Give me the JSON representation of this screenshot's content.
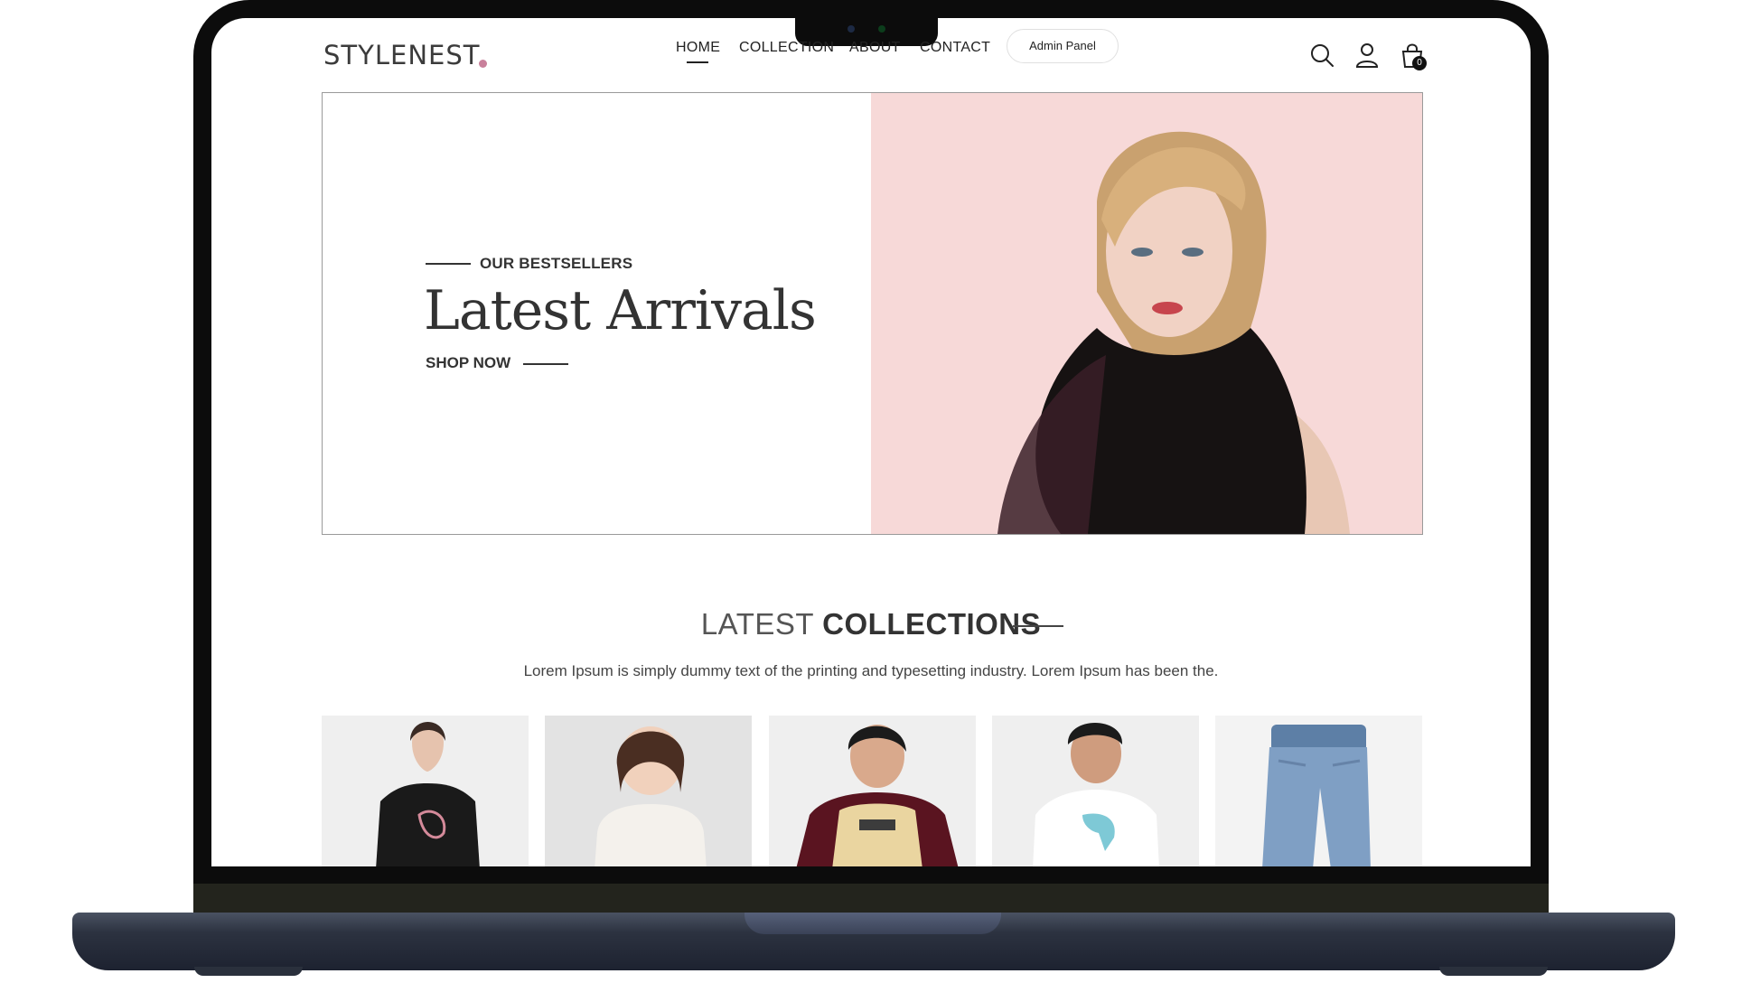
{
  "brand": {
    "logo_text": "STYLENEST",
    "accent_color": "#c9809b"
  },
  "nav": {
    "items": [
      "HOME",
      "COLLECTION",
      "ABOUT",
      "CONTACT"
    ],
    "admin_label": "Admin Panel",
    "cart_count": "0",
    "icons": [
      "search-icon",
      "user-icon",
      "cart-icon"
    ]
  },
  "hero": {
    "tagline": "OUR BESTSELLERS",
    "title": "Latest Arrivals",
    "cta": "SHOP NOW",
    "image_bg": "#f7d9d8"
  },
  "collections": {
    "title_light": "LATEST",
    "title_bold": "COLLECTIONS",
    "subtitle": "Lorem Ipsum is simply dummy text of the printing and typesetting industry. Lorem Ipsum has been the."
  },
  "products": [
    {
      "image": "woman in black t-shirt"
    },
    {
      "image": "girl in white top"
    },
    {
      "image": "man in raglan t-shirt"
    },
    {
      "image": "man in white t-shirt"
    },
    {
      "image": "blue denim jeans"
    }
  ]
}
